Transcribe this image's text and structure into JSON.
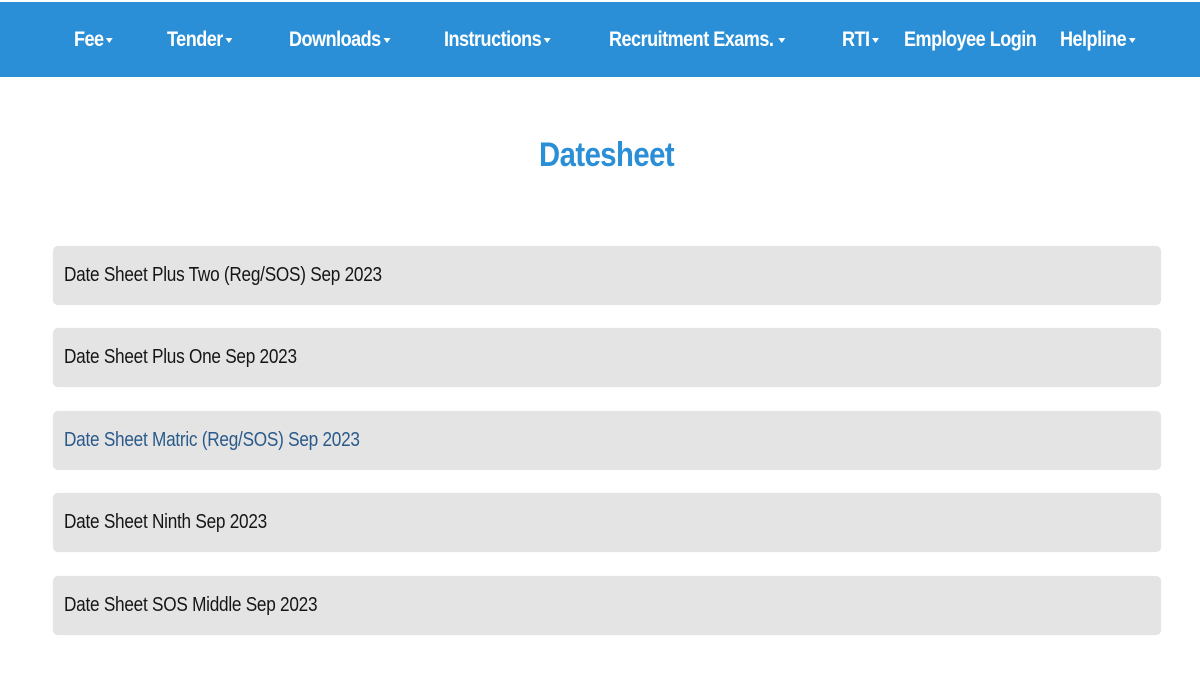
{
  "nav": {
    "background_color": "#2a8fd6",
    "items": [
      {
        "label": "Fee",
        "has_dropdown": true
      },
      {
        "label": "Tender",
        "has_dropdown": true
      },
      {
        "label": "Downloads",
        "has_dropdown": true
      },
      {
        "label": "Instructions",
        "has_dropdown": true
      },
      {
        "label": "Recruitment Exams.",
        "has_dropdown": true
      },
      {
        "label": "RTI",
        "has_dropdown": true
      },
      {
        "label": "Employee Login",
        "has_dropdown": false
      },
      {
        "label": "Helpline",
        "has_dropdown": true
      }
    ]
  },
  "main": {
    "title": "Datesheet",
    "title_color": "#2a8fd6",
    "items": [
      {
        "label": "Date Sheet Plus Two (Reg/SOS) Sep 2023",
        "active": false
      },
      {
        "label": "Date Sheet Plus One Sep 2023",
        "active": false
      },
      {
        "label": "Date Sheet Matric (Reg/SOS) Sep 2023",
        "active": true
      },
      {
        "label": "Date Sheet Ninth Sep 2023",
        "active": false
      },
      {
        "label": "Date Sheet SOS Middle Sep 2023",
        "active": false
      }
    ]
  }
}
